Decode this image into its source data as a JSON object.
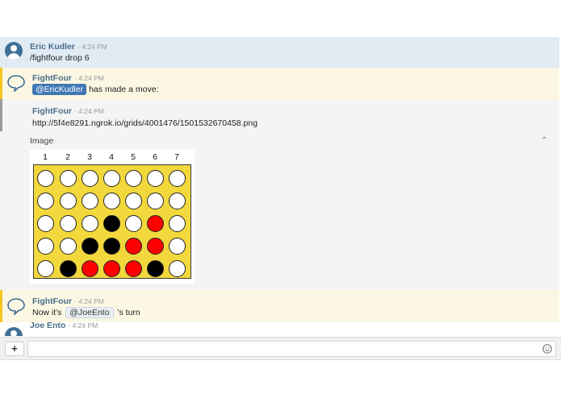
{
  "messages": [
    {
      "author": "Eric Kudler",
      "time": "· 4:24 PM",
      "text": "/fightfour drop 6"
    },
    {
      "author": "FightFour",
      "time": "· 4:24 PM",
      "mention": "@EricKudler",
      "text": "has made a move:"
    },
    {
      "author": "FightFour",
      "time": "· 4:24 PM",
      "link": "http://5f4e8291.ngrok.io/grids/4001476/1501532670458.png"
    },
    {
      "image_label": "Image"
    },
    {
      "author": "FightFour",
      "time": "· 4:24 PM",
      "text_before": "Now it's",
      "mention": "@JoeEnto",
      "text_after": "'s turn"
    },
    {
      "author": "Joe Ento",
      "time": "· 4:24 PM"
    }
  ],
  "board": {
    "column_numbers": [
      "1",
      "2",
      "3",
      "4",
      "5",
      "6",
      "7"
    ],
    "grid": [
      [
        "white",
        "white",
        "white",
        "white",
        "white",
        "white",
        "white"
      ],
      [
        "white",
        "white",
        "white",
        "white",
        "white",
        "white",
        "white"
      ],
      [
        "white",
        "white",
        "white",
        "black",
        "white",
        "red",
        "white"
      ],
      [
        "white",
        "white",
        "black",
        "black",
        "red",
        "red",
        "white"
      ],
      [
        "white",
        "black",
        "red",
        "red",
        "red",
        "black",
        "white"
      ]
    ],
    "colors": {
      "white": "#ffffff",
      "black": "#000000",
      "red": "#ff0000",
      "board": "#f2d83c"
    }
  },
  "composer": {
    "plus_label": "+",
    "placeholder": "",
    "value": ""
  },
  "icons": {
    "collapse": "chevron-up-icon",
    "emoji": "smiley-icon",
    "user_avatar": "user-avatar-icon",
    "bot_avatar": "speech-bubble-icon"
  }
}
